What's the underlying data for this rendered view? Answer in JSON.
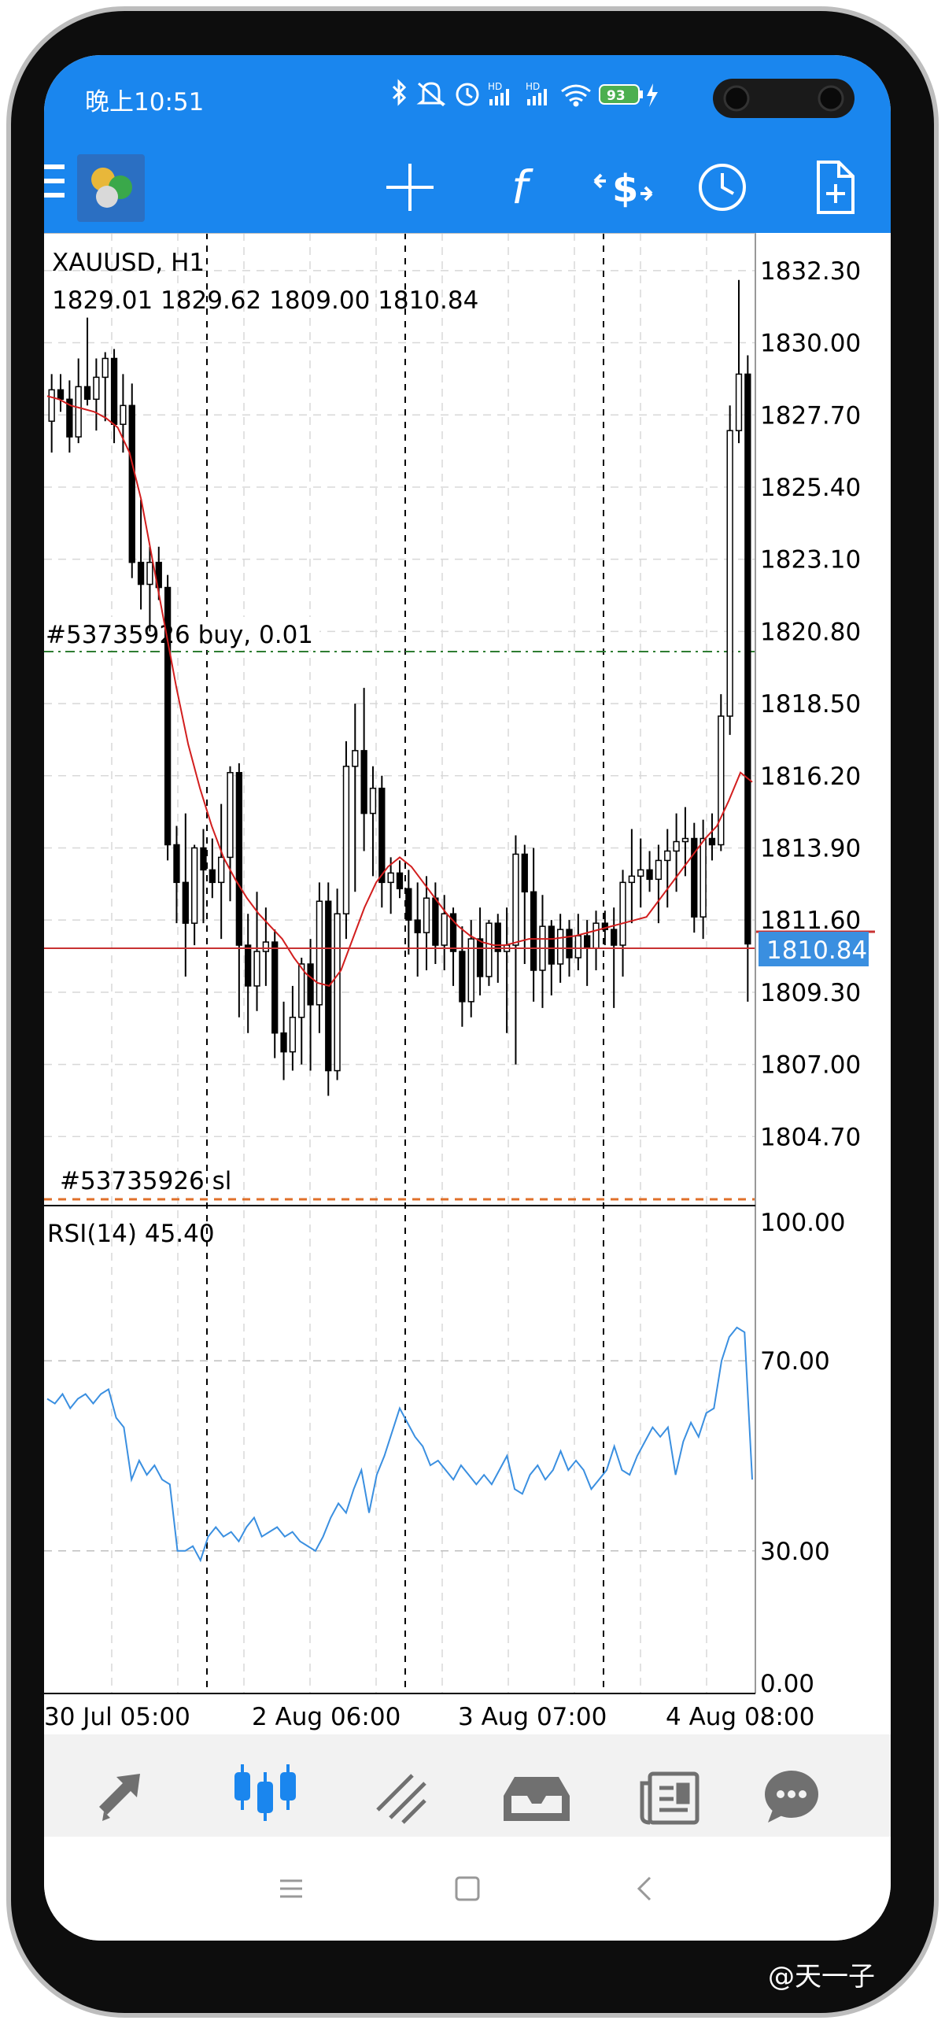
{
  "status_bar": {
    "time": "晚上10:51",
    "battery": "93",
    "hd_label": "HD",
    "icons": [
      "bluetooth-icon",
      "mute-icon",
      "alarm-icon",
      "hd-signal-icon",
      "hd-signal-icon",
      "wifi-icon",
      "battery-icon",
      "charging-icon"
    ]
  },
  "toolbar": {
    "icons": [
      "menu-icon",
      "app-logo-icon",
      "crosshair-icon",
      "indicators-f-icon",
      "trade-dollar-icon",
      "timeframe-clock-icon",
      "new-order-icon"
    ]
  },
  "chart": {
    "symbol_line": "XAUUSD, H1",
    "ohlc_line": "1829.01 1829.62 1809.00 1810.84",
    "current_price": "1810.84",
    "position_label": "#53735926 buy, 0.01",
    "sl_label": "#53735926 sl",
    "price_axis": [
      "1832.30",
      "1830.00",
      "1827.70",
      "1825.40",
      "1823.10",
      "1820.80",
      "1818.50",
      "1816.20",
      "1813.90",
      "1811.60",
      "1809.30",
      "1807.00",
      "1804.70"
    ],
    "rsi_label": "RSI(14) 45.40",
    "rsi_axis": [
      "100.00",
      "70.00",
      "30.00",
      "0.00"
    ],
    "time_axis": [
      "30 Jul 05:00",
      "2 Aug 06:00",
      "3 Aug 07:00",
      "4 Aug 08:00"
    ],
    "colors": {
      "bull": "#ffffff",
      "bear": "#000000",
      "ma": "#d21e1e",
      "rsi": "#3a8fe0",
      "buy_line": "#2e7d32",
      "sl_line": "#e0702a",
      "price_tag": "#3a8fe0"
    }
  },
  "chart_data": {
    "type": "candlestick",
    "title": "XAUUSD, H1",
    "ylim": [
      1802.5,
      1833.5
    ],
    "position_price": 1820.8,
    "current_price": 1810.84,
    "candles": [
      [
        1827.5,
        1829.0,
        1826.5,
        1828.5
      ],
      [
        1828.5,
        1829.0,
        1827.8,
        1828.2
      ],
      [
        1828.2,
        1828.8,
        1826.5,
        1827.0
      ],
      [
        1827.0,
        1829.5,
        1826.8,
        1828.6
      ],
      [
        1828.6,
        1830.8,
        1828.0,
        1828.2
      ],
      [
        1828.2,
        1829.5,
        1827.2,
        1828.9
      ],
      [
        1828.9,
        1829.7,
        1827.5,
        1829.5
      ],
      [
        1829.5,
        1829.8,
        1826.8,
        1827.4
      ],
      [
        1827.4,
        1829.0,
        1826.5,
        1828.0
      ],
      [
        1828.0,
        1828.7,
        1822.5,
        1823.0
      ],
      [
        1823.0,
        1825.0,
        1821.5,
        1822.3
      ],
      [
        1822.3,
        1823.5,
        1820.8,
        1823.0
      ],
      [
        1823.0,
        1823.5,
        1821.8,
        1822.2
      ],
      [
        1822.2,
        1822.6,
        1813.5,
        1814.0
      ],
      [
        1814.0,
        1814.6,
        1811.5,
        1812.8
      ],
      [
        1812.8,
        1815.0,
        1809.8,
        1811.5
      ],
      [
        1811.5,
        1814.0,
        1810.8,
        1813.9
      ],
      [
        1813.9,
        1814.5,
        1811.5,
        1813.2
      ],
      [
        1813.2,
        1814.2,
        1812.3,
        1812.8
      ],
      [
        1812.8,
        1815.3,
        1811.0,
        1813.6
      ],
      [
        1813.6,
        1816.5,
        1812.2,
        1816.3
      ],
      [
        1816.3,
        1816.6,
        1808.5,
        1810.8
      ],
      [
        1810.8,
        1811.8,
        1808.0,
        1809.5
      ],
      [
        1809.5,
        1812.5,
        1808.7,
        1810.6
      ],
      [
        1810.6,
        1812.0,
        1809.5,
        1810.9
      ],
      [
        1810.9,
        1811.3,
        1807.2,
        1808.0
      ],
      [
        1808.0,
        1809.0,
        1806.5,
        1807.4
      ],
      [
        1807.4,
        1809.5,
        1806.8,
        1808.5
      ],
      [
        1808.5,
        1810.4,
        1807.0,
        1810.2
      ],
      [
        1810.2,
        1811.0,
        1806.8,
        1808.9
      ],
      [
        1808.9,
        1812.8,
        1808.0,
        1812.2
      ],
      [
        1812.2,
        1812.8,
        1806.0,
        1806.8
      ],
      [
        1806.8,
        1812.6,
        1806.5,
        1811.8
      ],
      [
        1811.8,
        1817.3,
        1811.0,
        1816.5
      ],
      [
        1816.5,
        1818.5,
        1812.5,
        1817.0
      ],
      [
        1817.0,
        1819.0,
        1813.8,
        1815.0
      ],
      [
        1815.0,
        1816.5,
        1813.0,
        1815.8
      ],
      [
        1815.8,
        1816.2,
        1812.0,
        1812.8
      ],
      [
        1812.8,
        1813.6,
        1811.8,
        1813.1
      ],
      [
        1813.1,
        1813.5,
        1812.3,
        1812.6
      ],
      [
        1812.6,
        1813.2,
        1810.5,
        1811.6
      ],
      [
        1811.6,
        1812.8,
        1809.8,
        1811.2
      ],
      [
        1811.2,
        1813.0,
        1810.0,
        1812.3
      ],
      [
        1812.3,
        1812.8,
        1810.2,
        1810.8
      ],
      [
        1810.8,
        1812.4,
        1810.0,
        1811.8
      ],
      [
        1811.8,
        1812.0,
        1809.5,
        1810.6
      ],
      [
        1810.6,
        1811.4,
        1808.2,
        1809.0
      ],
      [
        1809.0,
        1811.6,
        1808.5,
        1811.0
      ],
      [
        1811.0,
        1812.0,
        1809.2,
        1809.8
      ],
      [
        1809.8,
        1811.6,
        1809.5,
        1811.5
      ],
      [
        1811.5,
        1811.8,
        1809.6,
        1810.6
      ],
      [
        1810.6,
        1812.0,
        1808.0,
        1810.8
      ],
      [
        1810.8,
        1814.3,
        1807.0,
        1813.7
      ],
      [
        1813.7,
        1814.0,
        1810.2,
        1812.5
      ],
      [
        1812.5,
        1813.9,
        1809.0,
        1810.0
      ],
      [
        1810.0,
        1812.4,
        1808.8,
        1811.4
      ],
      [
        1811.4,
        1811.6,
        1809.2,
        1810.2
      ],
      [
        1810.2,
        1811.8,
        1809.6,
        1811.3
      ],
      [
        1811.3,
        1811.6,
        1809.8,
        1810.4
      ],
      [
        1810.4,
        1811.8,
        1810.0,
        1811.1
      ],
      [
        1811.1,
        1811.6,
        1809.5,
        1810.7
      ],
      [
        1810.7,
        1811.9,
        1810.0,
        1811.5
      ],
      [
        1811.5,
        1811.9,
        1810.8,
        1811.3
      ],
      [
        1811.3,
        1812.0,
        1808.8,
        1810.8
      ],
      [
        1810.8,
        1813.2,
        1809.8,
        1812.8
      ],
      [
        1812.8,
        1814.5,
        1811.5,
        1813.0
      ],
      [
        1813.0,
        1814.2,
        1812.0,
        1813.2
      ],
      [
        1813.2,
        1813.8,
        1812.5,
        1812.9
      ],
      [
        1812.9,
        1814.0,
        1811.5,
        1813.5
      ],
      [
        1813.5,
        1814.5,
        1812.0,
        1813.8
      ],
      [
        1813.8,
        1815.0,
        1812.5,
        1814.1
      ],
      [
        1814.1,
        1815.2,
        1813.0,
        1814.2
      ],
      [
        1814.2,
        1814.7,
        1811.2,
        1811.7
      ],
      [
        1811.7,
        1814.8,
        1811.0,
        1814.2
      ],
      [
        1814.2,
        1815.0,
        1813.5,
        1814.0
      ],
      [
        1814.0,
        1818.8,
        1813.8,
        1818.1
      ],
      [
        1818.1,
        1828.0,
        1817.5,
        1827.2
      ],
      [
        1827.2,
        1832.0,
        1826.8,
        1829.0
      ],
      [
        1829.0,
        1829.6,
        1809.0,
        1810.84
      ]
    ],
    "ma": [
      1828.3,
      1828.2,
      1828.0,
      1827.9,
      1827.8,
      1827.6,
      1827.3,
      1826.5,
      1825.0,
      1823.0,
      1821.0,
      1819.0,
      1817.2,
      1815.8,
      1814.6,
      1813.6,
      1812.9,
      1812.3,
      1811.8,
      1811.4,
      1811.0,
      1810.4,
      1809.9,
      1809.6,
      1809.5,
      1810.0,
      1811.0,
      1812.0,
      1812.8,
      1813.3,
      1813.6,
      1813.3,
      1812.8,
      1812.3,
      1811.8,
      1811.4,
      1811.1,
      1810.9,
      1810.8,
      1810.8,
      1810.9,
      1811.0,
      1811.0,
      1811.0,
      1811.05,
      1811.1,
      1811.2,
      1811.3,
      1811.4,
      1811.5,
      1811.6,
      1811.7,
      1812.2,
      1812.7,
      1813.2,
      1813.7,
      1814.2,
      1814.6,
      1815.4,
      1816.3,
      1816.0
    ],
    "rsi": [
      62,
      61,
      63,
      60,
      62,
      63,
      61,
      63,
      64,
      58,
      56,
      45,
      49,
      46,
      48,
      45,
      44,
      30,
      30,
      31,
      28,
      33,
      35,
      33,
      34,
      32,
      35,
      37,
      33,
      34,
      35,
      33,
      34,
      32,
      31,
      30,
      33,
      37,
      40,
      38,
      43,
      47,
      38,
      46,
      50,
      55,
      60,
      57,
      54,
      52,
      48,
      49,
      47,
      45,
      48,
      46,
      44,
      46,
      44,
      47,
      50,
      43,
      42,
      46,
      48,
      45,
      47,
      51,
      47,
      49,
      47,
      43,
      45,
      47,
      52,
      47,
      46,
      50,
      53,
      56,
      54,
      56,
      46,
      53,
      57,
      54,
      59,
      60,
      70,
      75,
      77,
      76,
      45
    ]
  },
  "bottom_nav": {
    "items": [
      "quotes-icon",
      "chart-candles-icon",
      "trade-icon",
      "history-inbox-icon",
      "news-icon",
      "messages-icon"
    ]
  },
  "system_nav": {
    "items": [
      "recents-icon",
      "home-icon",
      "back-icon"
    ]
  },
  "watermark": "@天一子"
}
